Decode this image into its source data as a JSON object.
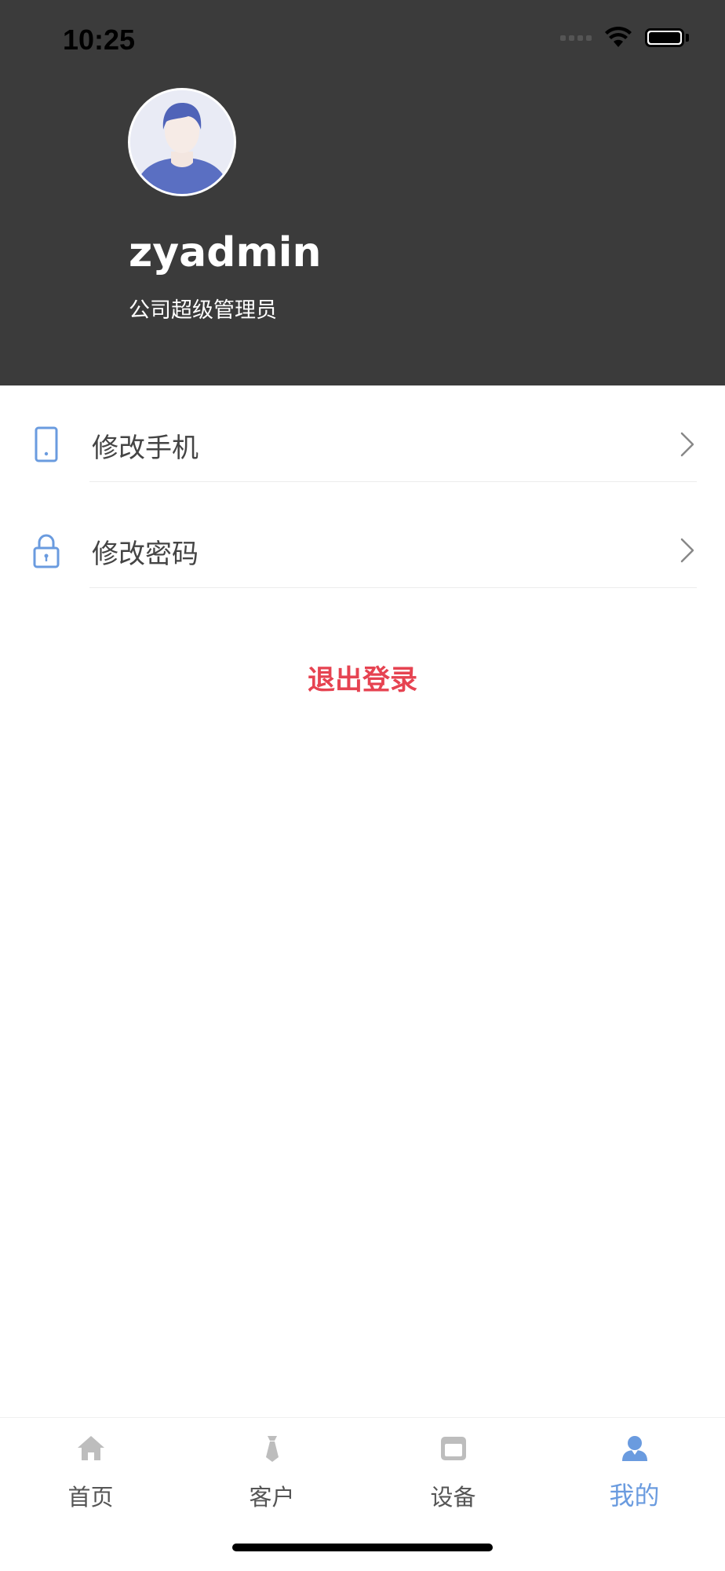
{
  "status_bar": {
    "time": "10:25"
  },
  "profile": {
    "username": "zyadmin",
    "role": "公司超级管理员"
  },
  "menu": [
    {
      "label": "修改手机",
      "icon": "phone-icon"
    },
    {
      "label": "修改密码",
      "icon": "lock-icon"
    }
  ],
  "logout_label": "退出登录",
  "tabs": [
    {
      "label": "首页",
      "icon": "home-icon",
      "active": false
    },
    {
      "label": "客户",
      "icon": "tie-icon",
      "active": false
    },
    {
      "label": "设备",
      "icon": "device-icon",
      "active": false
    },
    {
      "label": "我的",
      "icon": "user-icon",
      "active": true
    }
  ],
  "colors": {
    "header_bg": "#3b3b3b",
    "accent_blue": "#6a9bdf",
    "logout_red": "#e64351",
    "inactive_tab": "#bdbdbd"
  }
}
